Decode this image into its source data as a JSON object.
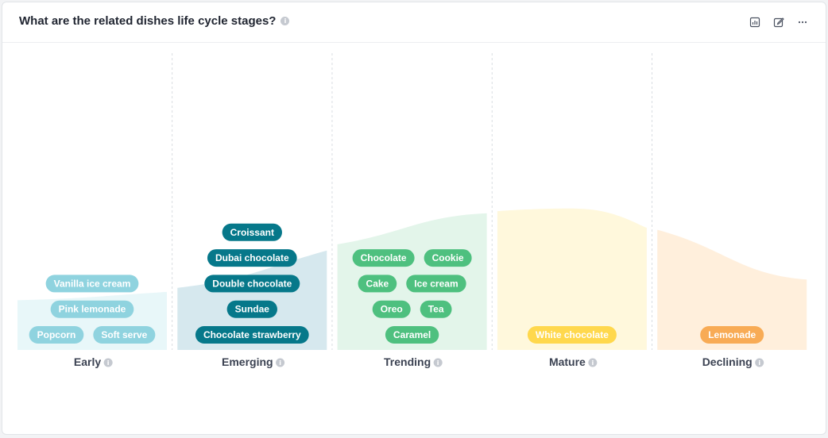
{
  "header": {
    "title": "What are the related dishes life cycle stages?",
    "info_icon": "info-icon",
    "tools": [
      {
        "name": "chart-settings-icon"
      },
      {
        "name": "edit-icon"
      },
      {
        "name": "more-icon"
      }
    ]
  },
  "chart_data": {
    "type": "area",
    "title": "What are the related dishes life cycle stages?",
    "curve_levels": [
      [
        0.24,
        0.28
      ],
      [
        0.3,
        0.48
      ],
      [
        0.51,
        0.66
      ],
      [
        0.67,
        0.59
      ],
      [
        0.58,
        0.34
      ]
    ],
    "stages": [
      {
        "label": "Early",
        "area_color": "#e8f7f9",
        "pill_color": "#8fd3df",
        "pill_text_color": "#ffffff",
        "dishes": [
          [
            "Vanilla ice cream"
          ],
          [
            "Pink lemonade"
          ],
          [
            "Popcorn",
            "Soft serve"
          ]
        ]
      },
      {
        "label": "Emerging",
        "area_color": "#d6e8ee",
        "pill_color": "#06788a",
        "pill_text_color": "#ffffff",
        "dishes": [
          [
            "Croissant"
          ],
          [
            "Dubai chocolate"
          ],
          [
            "Double chocolate"
          ],
          [
            "Sundae"
          ],
          [
            "Chocolate strawberry"
          ]
        ]
      },
      {
        "label": "Trending",
        "area_color": "#e3f5ea",
        "pill_color": "#4ec07f",
        "pill_text_color": "#ffffff",
        "dishes": [
          [
            "Chocolate",
            "Cookie"
          ],
          [
            "Cake",
            "Ice cream"
          ],
          [
            "Oreo",
            "Tea"
          ],
          [
            "Caramel"
          ]
        ]
      },
      {
        "label": "Mature",
        "area_color": "#fff8dc",
        "pill_color": "#ffd84d",
        "pill_text_color": "#ffffff",
        "dishes": [
          [
            "White chocolate"
          ]
        ]
      },
      {
        "label": "Declining",
        "area_color": "#ffefdc",
        "pill_color": "#f8ab55",
        "pill_text_color": "#ffffff",
        "dishes": [
          [
            "Lemonade"
          ]
        ]
      }
    ]
  }
}
